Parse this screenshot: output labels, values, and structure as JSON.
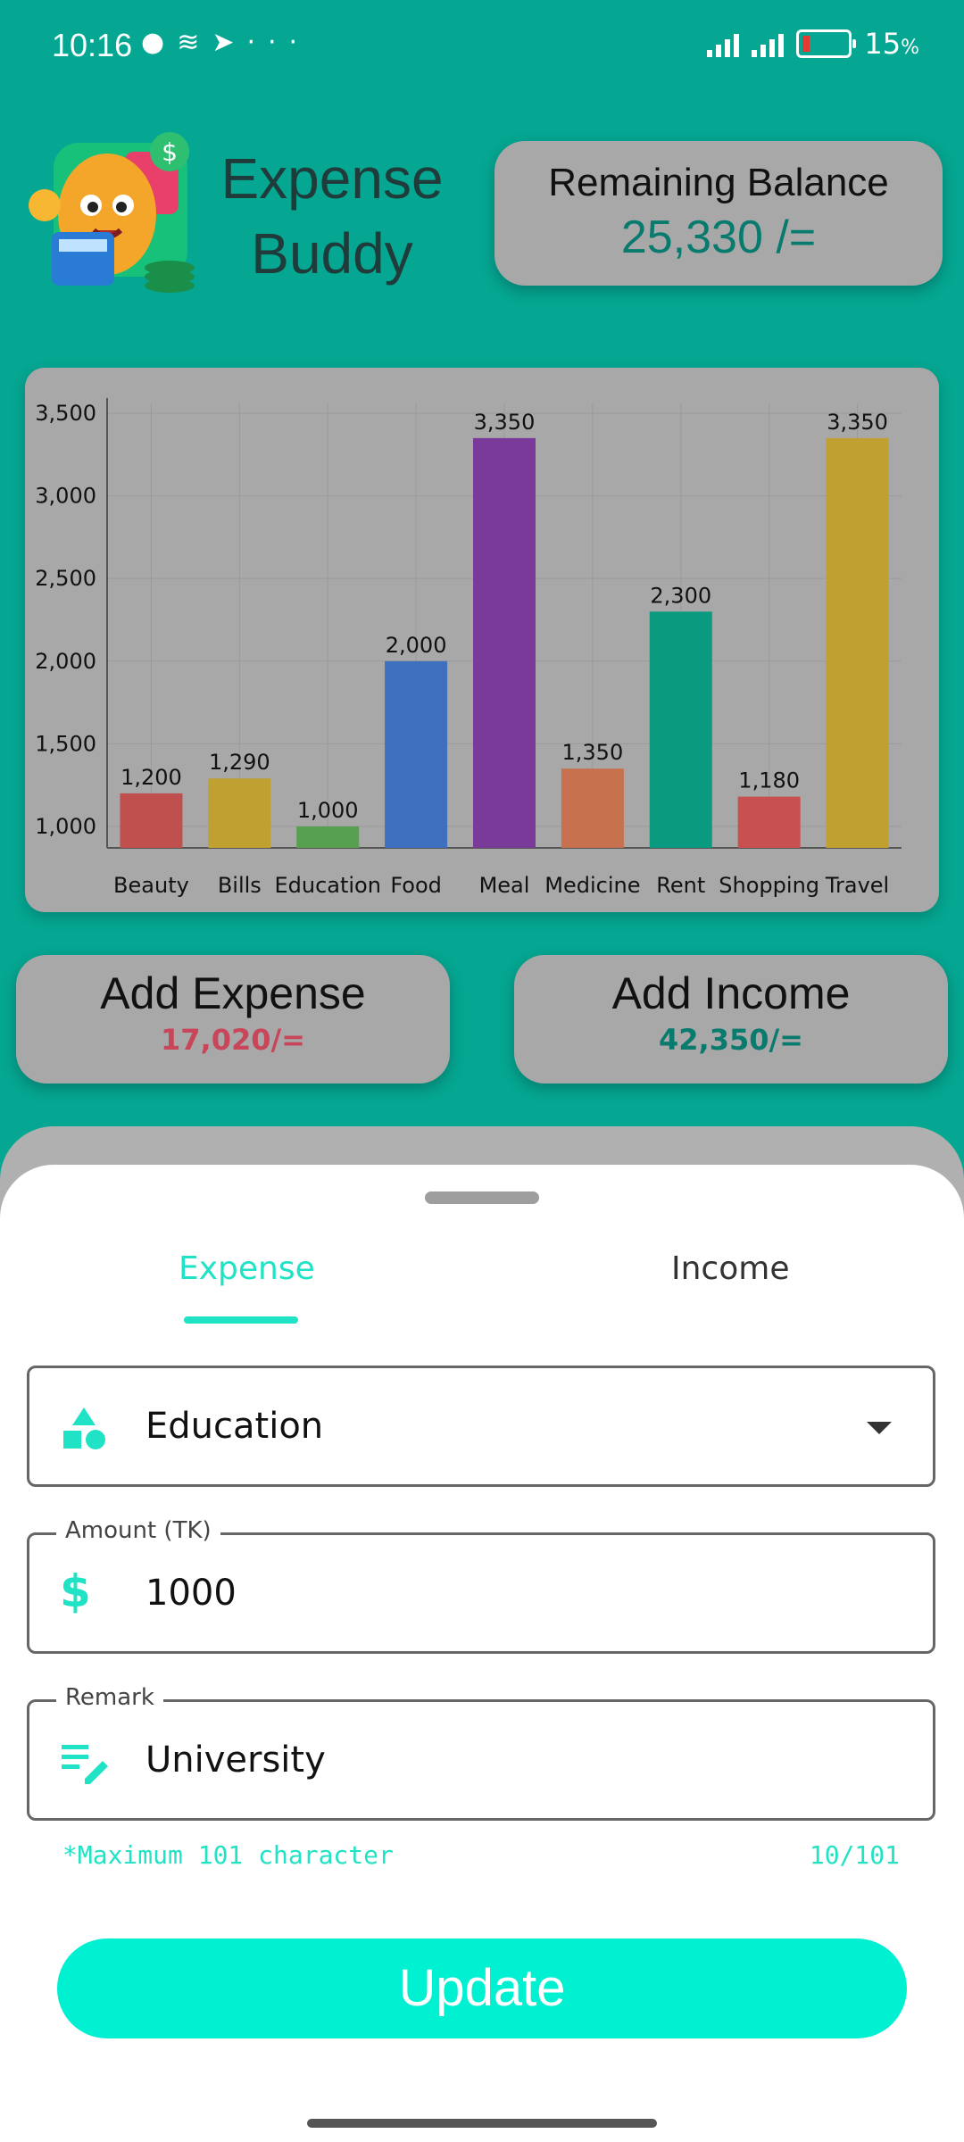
{
  "status_bar": {
    "time": "10:16",
    "battery_percent": "15",
    "battery_unit": "%"
  },
  "header": {
    "app_title_line1": "Expense",
    "app_title_line2": "Buddy",
    "balance_label": "Remaining Balance",
    "balance_value": "25,330  /="
  },
  "chart_data": {
    "type": "bar",
    "categories": [
      "Beauty",
      "Bills",
      "Education",
      "Food",
      "Meal",
      "Medicine",
      "Rent",
      "Shopping",
      "Travel"
    ],
    "values": [
      1200,
      1290,
      1000,
      2000,
      3350,
      1350,
      2300,
      1180,
      3350
    ],
    "value_labels": [
      "1,200",
      "1,290",
      "1,000",
      "2,000",
      "3,350",
      "1,350",
      "2,300",
      "1,180",
      "3,350"
    ],
    "colors": [
      "#c0504d",
      "#c0a030",
      "#56a050",
      "#3f6fbf",
      "#7a3a9a",
      "#c7714e",
      "#0a9a80",
      "#c85050",
      "#c0a030"
    ],
    "y_ticks": [
      1000,
      1500,
      2000,
      2500,
      3000,
      3500
    ],
    "y_tick_labels": [
      "1,000",
      "1,500",
      "2,000",
      "2,500",
      "3,000",
      "3,500"
    ],
    "ylim": [
      870,
      3560
    ],
    "grid": true
  },
  "actions": {
    "add_expense_label": "Add Expense",
    "add_expense_value": "17,020/=",
    "add_income_label": "Add Income",
    "add_income_value": "42,350/="
  },
  "sheet": {
    "tabs": [
      {
        "label": "Expense",
        "active": true
      },
      {
        "label": "Income",
        "active": false
      }
    ],
    "category_value": "Education",
    "amount_label": "Amount (TK)",
    "amount_value": "1000",
    "remark_label": "Remark",
    "remark_value": "University",
    "hint_left": "*Maximum 101 character",
    "hint_right": "10/101",
    "update_label": "Update"
  },
  "colors": {
    "accent": "#20e3c6",
    "primary_bg": "#05a792",
    "expense_red": "#c8455a",
    "income_teal": "#087a6e"
  }
}
